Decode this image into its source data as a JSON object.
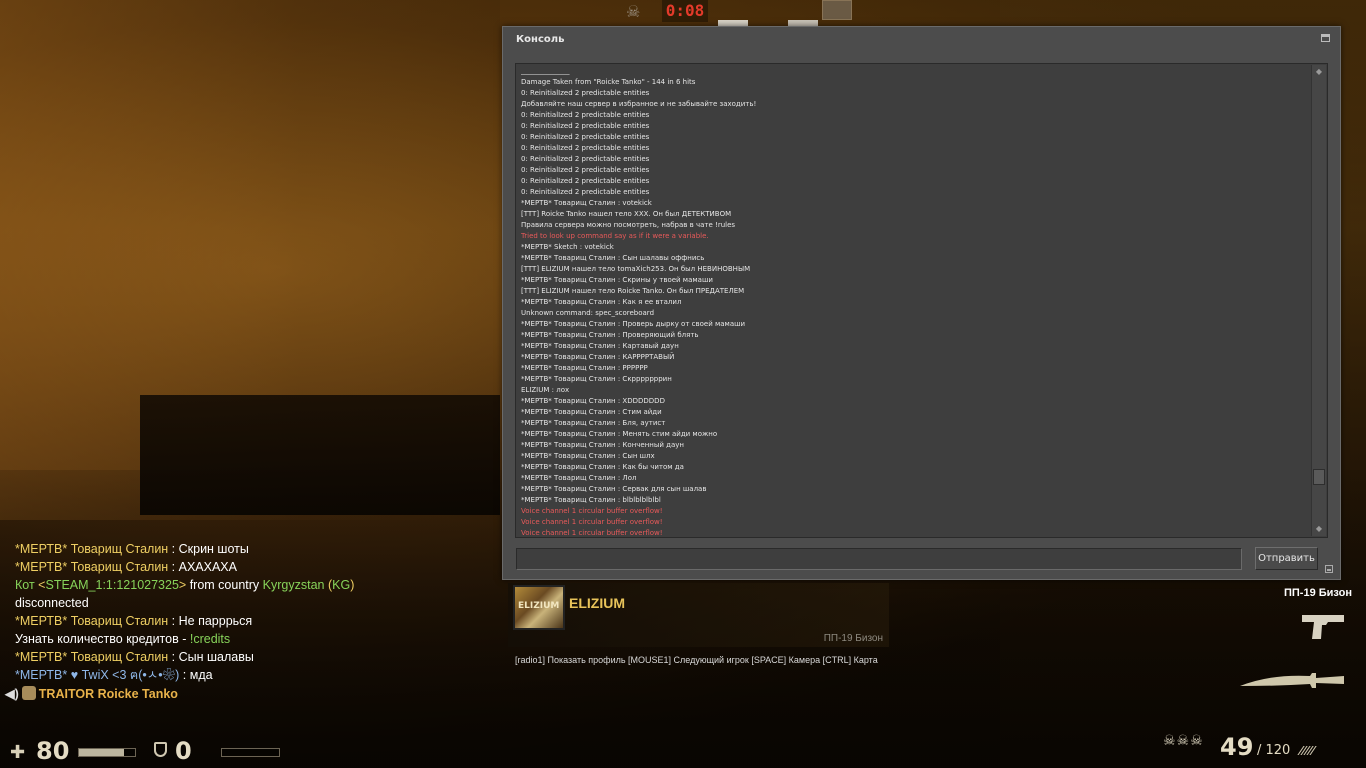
{
  "hud_top": {
    "timer": "0:08",
    "skull_icon": "skull-icon"
  },
  "console": {
    "title": "Консоль",
    "submit_label": "Отправить",
    "input_value": "",
    "lines": [
      {
        "text": "________________",
        "type": "sep"
      },
      {
        "text": "Damage Taken from \"Roicke Tanko\" - 144 in 6 hits",
        "type": "normal"
      },
      {
        "text": "0:   ReinitialIzed 2 predictable entities",
        "type": "normal"
      },
      {
        "text": "Добавляйте наш сервер в избранное и не забывайте заходить!",
        "type": "normal"
      },
      {
        "text": "0:   ReinitialIzed 2 predictable entities",
        "type": "normal"
      },
      {
        "text": "0:   ReinitialIzed 2 predictable entities",
        "type": "normal"
      },
      {
        "text": "0:   ReinitialIzed 2 predictable entities",
        "type": "normal"
      },
      {
        "text": "0:   ReinitialIzed 2 predictable entities",
        "type": "normal"
      },
      {
        "text": "0:   ReinitialIzed 2 predictable entities",
        "type": "normal"
      },
      {
        "text": "0:   ReinitialIzed 2 predictable entities",
        "type": "normal"
      },
      {
        "text": "0:   ReinitialIzed 2 predictable entities",
        "type": "normal"
      },
      {
        "text": "0:   ReinitialIzed 2 predictable entities",
        "type": "normal"
      },
      {
        "text": "*МЕРТВ* Товарищ Сталин : votekick",
        "type": "normal"
      },
      {
        "text": " [TTT] Roicke Tanko нашел тело ХХХ. Он был ДЕТЕКТИВОМ",
        "type": "normal"
      },
      {
        "text": "Правила сервера можно посмотреть, набрав в чате !rules",
        "type": "normal"
      },
      {
        "text": "Tried to look up command say as if it were a variable.",
        "type": "err"
      },
      {
        "text": "*МЕРТВ* Sketch : votekick",
        "type": "normal"
      },
      {
        "text": "*МЕРТВ* Товарищ Сталин : Сын шалавы оффнись",
        "type": "normal"
      },
      {
        "text": " [TTT] ELIZIUM нашел тело tomaXich253. Он был НЕВИНОВНЫМ",
        "type": "normal"
      },
      {
        "text": "*МЕРТВ* Товарищ Сталин : Скрины у твоей мамаши",
        "type": "normal"
      },
      {
        "text": " [TTT] ELIZIUM нашел тело Roicke Tanko. Он был ПРЕДАТЕЛЕМ",
        "type": "normal"
      },
      {
        "text": "*МЕРТВ* Товарищ Сталин : Как я ее вталил",
        "type": "normal"
      },
      {
        "text": "Unknown command: spec_scoreboard",
        "type": "normal"
      },
      {
        "text": "*МЕРТВ* Товарищ Сталин : Проверь дырку от своей мамаши",
        "type": "normal"
      },
      {
        "text": "*МЕРТВ* Товарищ Сталин : Проверяющий блять",
        "type": "normal"
      },
      {
        "text": "*МЕРТВ* Товарищ Сталин : Картавый даун",
        "type": "normal"
      },
      {
        "text": "*МЕРТВ* Товарищ Сталин : КАРРРРТАВЫЙ",
        "type": "normal"
      },
      {
        "text": "*МЕРТВ* Товарищ Сталин : РРРРРР",
        "type": "normal"
      },
      {
        "text": "*МЕРТВ* Товарищ Сталин : Скрррррррин",
        "type": "normal"
      },
      {
        "text": "ELIZIUM : лох",
        "type": "normal"
      },
      {
        "text": "*МЕРТВ* Товарищ Сталин : ХDDDDDDD",
        "type": "normal"
      },
      {
        "text": "*МЕРТВ* Товарищ Сталин : Стим айди",
        "type": "normal"
      },
      {
        "text": "*МЕРТВ* Товарищ Сталин : Бля, аутист",
        "type": "normal"
      },
      {
        "text": "*МЕРТВ* Товарищ Сталин : Менять стим айди можно",
        "type": "normal"
      },
      {
        "text": "*МЕРТВ* Товарищ Сталин : Конченный даун",
        "type": "normal"
      },
      {
        "text": "*МЕРТВ* Товарищ Сталин : Сын шлх",
        "type": "normal"
      },
      {
        "text": "*МЕРТВ* Товарищ Сталин : Как бы читом да",
        "type": "normal"
      },
      {
        "text": "*МЕРТВ* Товарищ Сталин : Лол",
        "type": "normal"
      },
      {
        "text": "*МЕРТВ* Товарищ Сталин : Сервак для сын шалав",
        "type": "normal"
      },
      {
        "text": "*МЕРТВ* Товарищ Сталин : blblblblblbl",
        "type": "normal"
      },
      {
        "text": "Voice channel 1 circular buffer overflow!",
        "type": "err"
      },
      {
        "text": "Voice channel 1 circular buffer overflow!",
        "type": "err"
      },
      {
        "text": "Voice channel 1 circular buffer overflow!",
        "type": "err"
      }
    ]
  },
  "spectator": {
    "avatar_text": "ELIZIUM",
    "name": "ELIZIUM",
    "weapon": "ПП-19 Бизон",
    "hint": "[radio1] Показать профиль [MOUSE1] Следующий игрок [SPACE] Камера [CTRL] Карта"
  },
  "chat": {
    "line1_prefix": "*МЕРТВ* Товарищ Сталин",
    "line1_text": " : Скрин шоты",
    "line2_prefix": "*МЕРТВ* Товарищ Сталин",
    "line2_text": " : АХАХАХА",
    "line3_kot": " Кот ",
    "line3_steam_open": "<",
    "line3_steam": "STEAM_1:1:121027325",
    "line3_steam_close": ">",
    "line3_from": " from country ",
    "line3_country": "Kyrgyzstan",
    "line3_code_open": " (",
    "line3_code": "KG",
    "line3_code_close": ")",
    "line4": "disconnected",
    "line5_prefix": "*МЕРТВ* Товарищ Сталин",
    "line5_text": " : Не паррpься",
    "line6_text": "Узнать количество кредитов - ",
    "line6_cmd": "!credits",
    "line7_prefix": "*МЕРТВ* Товарищ Сталин",
    "line7_text": " : Сын шалавы",
    "line8_prefix": "*МЕРТВ* ♥ TwiX <3 ฅ(•ㅅ•❀)",
    "line8_text": " : мда",
    "traitor_label": "TRAITOR Roicke Tanko"
  },
  "hud_bottom": {
    "health": "80",
    "health_fraction": 0.8,
    "armor": "0",
    "weapon_num": "ПП-19",
    "weapon_name": " Бизон",
    "ammo": "49",
    "ammo_reserve": "/ 120",
    "ammo_bullets": "/////",
    "skulls": "☠☠☠"
  },
  "colors": {
    "accent_yellow": "#efcf63",
    "chat_green": "#87d35a",
    "error_red": "#e85a5a",
    "timer_red": "#e23a2a",
    "console_bg": "#4c4c4c"
  }
}
